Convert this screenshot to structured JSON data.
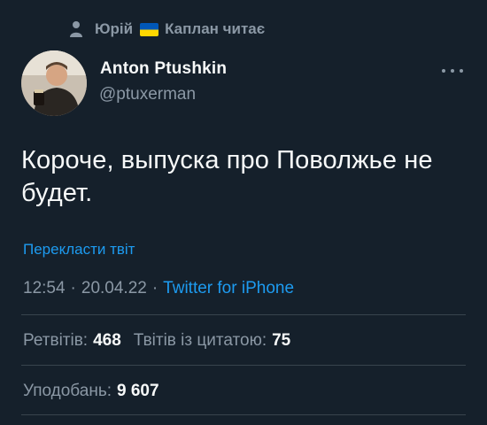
{
  "social_context": {
    "name_part1": "Юрій",
    "name_part2": "Каплан",
    "action": "читає",
    "icon": "person-icon",
    "flag": "ukraine-flag-icon"
  },
  "author": {
    "name": "Anton Ptushkin",
    "handle": "@ptuxerman",
    "avatar_icon": "avatar"
  },
  "tweet": {
    "text": "Короче, выпуска про Поволжье не будет.",
    "translate_label": "Перекласти твіт"
  },
  "meta": {
    "time": "12:54",
    "separator": "·",
    "date": "20.04.22",
    "source": "Twitter for iPhone"
  },
  "stats": {
    "retweets_label": "Ретвітів:",
    "retweets_value": "468",
    "quotes_label": "Твітів із цитатою:",
    "quotes_value": "75",
    "likes_label": "Уподобань:",
    "likes_value": "9 607"
  },
  "colors": {
    "background": "#15202b",
    "accent": "#1d9bf0",
    "muted": "#8b98a5",
    "text": "#f7f9f9"
  }
}
